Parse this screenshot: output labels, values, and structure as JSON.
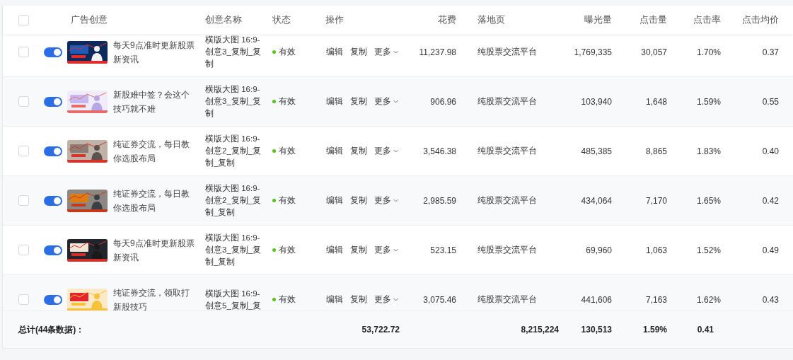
{
  "table": {
    "header_checkbox": {
      "checked": false
    },
    "columns": [
      "广告创意",
      "创意名称",
      "状态",
      "操作",
      "花费",
      "落地页",
      "曝光量",
      "点击量",
      "点击率",
      "点击均价"
    ],
    "rows": [
      {
        "checked": false,
        "on": true,
        "title": "每天9点准时更新股票新资讯",
        "name": "横版大图 16:9-创意3_复制_复制",
        "status": "有效",
        "actions": [
          "编辑",
          "复制",
          "更多"
        ],
        "spend": "11,237.98",
        "landing": "纯股票交流平台",
        "impressions": "1,769,335",
        "clicks": "30,057",
        "ctr": "1.70%",
        "cpc": "0.37"
      },
      {
        "checked": false,
        "on": true,
        "title": "新股难中签？会这个技巧就不难",
        "name": "横版大图 16:9-创意3_复制_复制",
        "status": "有效",
        "actions": [
          "编辑",
          "复制",
          "更多"
        ],
        "spend": "906.96",
        "landing": "纯股票交流平台",
        "impressions": "103,940",
        "clicks": "1,648",
        "ctr": "1.59%",
        "cpc": "0.55"
      },
      {
        "checked": false,
        "on": true,
        "title": "纯证券交流，每日教你选股布局",
        "name": "横版大图 16:9-创意2_复制_复制_复制",
        "status": "有效",
        "actions": [
          "编辑",
          "复制",
          "更多"
        ],
        "spend": "3,546.38",
        "landing": "纯股票交流平台",
        "impressions": "485,385",
        "clicks": "8,865",
        "ctr": "1.83%",
        "cpc": "0.40"
      },
      {
        "checked": false,
        "on": true,
        "title": "纯证券交流，每日教你选股布局",
        "name": "横版大图 16:9-创意2_复制_复制_复制",
        "status": "有效",
        "actions": [
          "编辑",
          "复制",
          "更多"
        ],
        "spend": "2,985.59",
        "landing": "纯股票交流平台",
        "impressions": "434,064",
        "clicks": "7,170",
        "ctr": "1.65%",
        "cpc": "0.42"
      },
      {
        "checked": false,
        "on": true,
        "title": "每天9点准时更新股票新资讯",
        "name": "横版大图 16:9-创意3_复制_复制_复制",
        "status": "有效",
        "actions": [
          "编辑",
          "复制",
          "更多"
        ],
        "spend": "523.15",
        "landing": "纯股票交流平台",
        "impressions": "69,960",
        "clicks": "1,063",
        "ctr": "1.52%",
        "cpc": "0.49"
      },
      {
        "checked": false,
        "on": true,
        "title": "纯证券交流，领取打新股技巧",
        "name": "横版大图 16:9-创意5_复制_复",
        "status": "有效",
        "actions": [
          "编辑",
          "复制",
          "更多"
        ],
        "spend": "3,075.46",
        "landing": "纯股票交流平台",
        "impressions": "441,606",
        "clicks": "7,163",
        "ctr": "1.62%",
        "cpc": "0.43"
      }
    ],
    "total": {
      "label": "总计(44条数据)：",
      "spend": "53,722.72",
      "impressions": "8,215,224",
      "clicks": "130,513",
      "ctr": "1.59%",
      "cpc": "0.41"
    }
  }
}
